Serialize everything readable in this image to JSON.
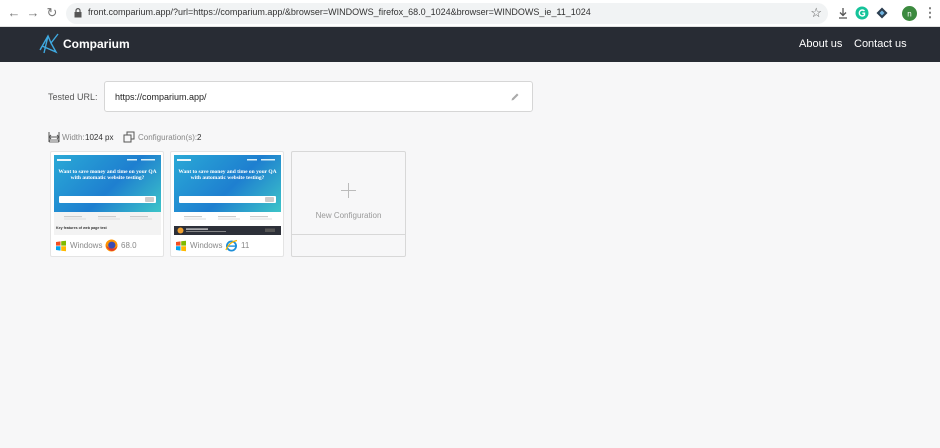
{
  "browser": {
    "url": "front.comparium.app/?url=https://comparium.app/&browser=WINDOWS_firefox_68.0_1024&browser=WINDOWS_ie_11_1024",
    "profile_initial": "n"
  },
  "header": {
    "brand": "Comparium",
    "nav": [
      "About us",
      "Contact us"
    ]
  },
  "tested_url": {
    "label": "Tested URL:",
    "value": "https://comparium.app/"
  },
  "meta": {
    "width_label": "Width:",
    "width_value": "1024 px",
    "config_label": "Configuration(s):",
    "config_value": "2"
  },
  "configurations": [
    {
      "thumb_title": "Want to save money and time on your QA with automatic website testing?",
      "thumb_feature": "Key features of web page test",
      "os": "Windows",
      "browser_icon": "firefox-icon",
      "version": "68.0"
    },
    {
      "thumb_title": "Want to save money and time on your QA with automatic website testing?",
      "os": "Windows",
      "browser_icon": "internet-explorer-icon",
      "version": "11"
    }
  ],
  "new_configuration": {
    "label": "New Configuration"
  },
  "colors": {
    "header_bg": "#282c34",
    "accent": "#2aa9d6",
    "page_bg": "#f7f7f8"
  }
}
